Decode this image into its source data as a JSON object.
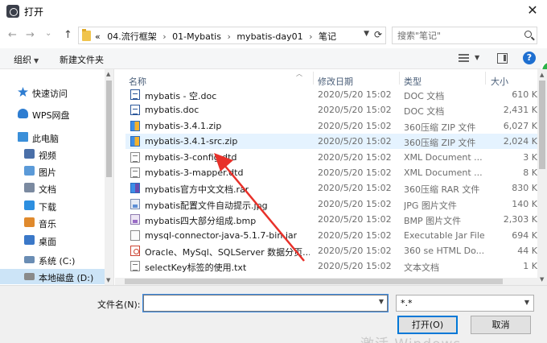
{
  "window": {
    "title": "打开",
    "close_glyph": "✕"
  },
  "nav": {
    "back_glyph": "←",
    "forward_glyph": "→",
    "history_glyph": "⌄",
    "up_glyph": "↑",
    "overflow": "«",
    "breadcrumbs": [
      "04.流行框架",
      "01-Mybatis",
      "mybatis-day01",
      "笔记"
    ],
    "crumb_sep": "›",
    "search_placeholder": "搜索\"笔记\""
  },
  "toolbar": {
    "organize": "组织",
    "new_folder": "新建文件夹",
    "help": "?"
  },
  "sidebar": {
    "items": [
      {
        "label": "快速访问",
        "icon": "star-icon",
        "color": "#2e7dd1"
      },
      {
        "label": "WPS网盘",
        "icon": "cloud-icon",
        "color": "#2e7dd1"
      },
      {
        "label": "此电脑",
        "icon": "computer-icon",
        "color": "#3a8fd9"
      },
      {
        "label": "视频",
        "icon": "video-folder-icon",
        "color": "#4a6fa8"
      },
      {
        "label": "图片",
        "icon": "pictures-folder-icon",
        "color": "#5b9ad8"
      },
      {
        "label": "文档",
        "icon": "documents-folder-icon",
        "color": "#7b8aa0"
      },
      {
        "label": "下载",
        "icon": "download-folder-icon",
        "color": "#2d8fe0"
      },
      {
        "label": "音乐",
        "icon": "music-folder-icon",
        "color": "#e08a2d"
      },
      {
        "label": "桌面",
        "icon": "desktop-folder-icon",
        "color": "#3b78c8"
      },
      {
        "label": "系统 (C:)",
        "icon": "drive-c-icon",
        "color": "#6a8db4"
      },
      {
        "label": "本地磁盘 (D:)",
        "icon": "drive-d-icon",
        "color": "#8a8a8a"
      }
    ]
  },
  "columns": {
    "name": "名称",
    "date": "修改日期",
    "type": "类型",
    "size": "大小"
  },
  "files": [
    {
      "name": "mybatis - 空.doc",
      "date": "2020/5/20 15:02",
      "type": "DOC 文档",
      "size": "610 K",
      "icon": "doc"
    },
    {
      "name": "mybatis.doc",
      "date": "2020/5/20 15:02",
      "type": "DOC 文档",
      "size": "2,431 K",
      "icon": "doc"
    },
    {
      "name": "mybatis-3.4.1.zip",
      "date": "2020/5/20 15:02",
      "type": "360压缩 ZIP 文件",
      "size": "6,027 K",
      "icon": "zip"
    },
    {
      "name": "mybatis-3.4.1-src.zip",
      "date": "2020/5/20 15:02",
      "type": "360压缩 ZIP 文件",
      "size": "2,024 K",
      "icon": "zip"
    },
    {
      "name": "mybatis-3-config.dtd",
      "date": "2020/5/20 15:02",
      "type": "XML Document ...",
      "size": "3 K",
      "icon": "dtd"
    },
    {
      "name": "mybatis-3-mapper.dtd",
      "date": "2020/5/20 15:02",
      "type": "XML Document ...",
      "size": "8 K",
      "icon": "dtd"
    },
    {
      "name": "mybatis官方中文文档.rar",
      "date": "2020/5/20 15:02",
      "type": "360压缩 RAR 文件",
      "size": "830 K",
      "icon": "rar"
    },
    {
      "name": "mybatis配置文件自动提示.jpg",
      "date": "2020/5/20 15:02",
      "type": "JPG 图片文件",
      "size": "140 K",
      "icon": "img"
    },
    {
      "name": "mybatis四大部分组成.bmp",
      "date": "2020/5/20 15:02",
      "type": "BMP 图片文件",
      "size": "2,303 K",
      "icon": "bmp"
    },
    {
      "name": "mysql-connector-java-5.1.7-bin.jar",
      "date": "2020/5/20 15:02",
      "type": "Executable Jar File",
      "size": "694 K",
      "icon": "jar"
    },
    {
      "name": "Oracle、MySql、SQLServer 数据分页...",
      "date": "2020/5/20 15:02",
      "type": "360 se HTML Do...",
      "size": "44 K",
      "icon": "html"
    },
    {
      "name": "selectKey标签的使用.txt",
      "date": "2020/5/20 15:02",
      "type": "文本文档",
      "size": "1 K",
      "icon": "txt"
    }
  ],
  "bottom": {
    "filename_label": "文件名(N):",
    "filename_value": "",
    "filter_value": "*.*",
    "open_button": "打开(O)",
    "cancel_button": "取消",
    "watermark": "激活 Windows"
  },
  "colors": {
    "accent": "#0078d7",
    "selection": "#cce4f7",
    "hover_row": "#e5f3ff",
    "arrow": "#e8312a"
  }
}
